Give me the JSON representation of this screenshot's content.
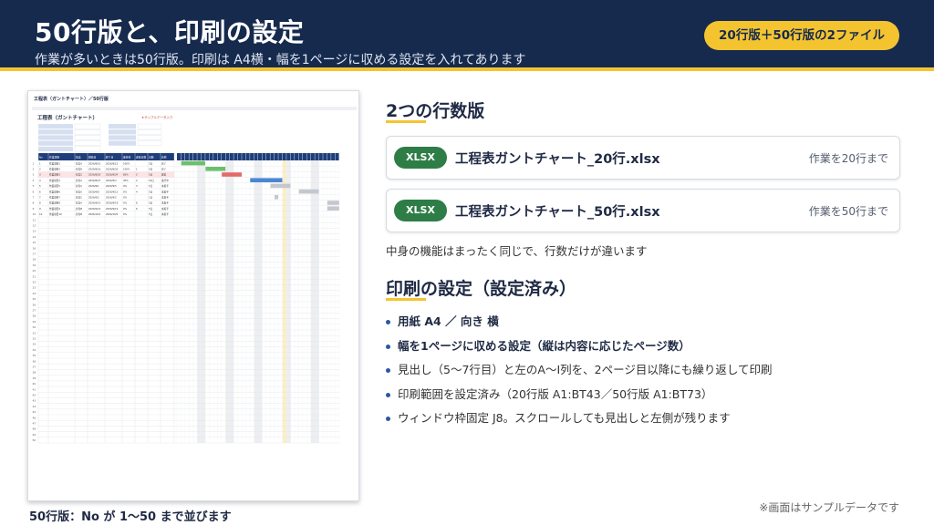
{
  "header": {
    "title": "50行版と、印刷の設定",
    "subtitle": "作業が多いときは50行版。印刷は A4横・幅を1ページに収める設定を入れてあります",
    "badge": "20行版＋50行版の2ファイル"
  },
  "screenshot": {
    "sheet_title": "工程表（ガントチャート）／50行版",
    "block_title": "工程表（ガントチャート）",
    "sample_note": "★サンプルデータ入り",
    "columns": [
      "No",
      "作業項目",
      "担当",
      "開始日",
      "終了日",
      "進捗率",
      "遅延日数",
      "日数",
      "状態"
    ],
    "rows": [
      [
        "1",
        "作業項目1",
        "担当A",
        "2026/8/10",
        "2026/8/15",
        "100%",
        "",
        "5日",
        "完了"
      ],
      [
        "2",
        "作業項目2",
        "担当B",
        "2026/8/16",
        "2026/8/20",
        "100%",
        "1",
        "5日",
        "完了"
      ],
      [
        "3",
        "作業項目3",
        "担当C",
        "2026/8/20",
        "2026/8/24",
        "60%",
        "2",
        "5日",
        "遅延"
      ],
      [
        "4",
        "作業項目4",
        "担当A",
        "2026/8/27",
        "2026/9/3",
        "30%",
        "2",
        "10日",
        "進行中"
      ],
      [
        "5",
        "作業項目5",
        "担当C",
        "2026/9/1",
        "2026/9/5",
        "0%",
        "3",
        "5日",
        "未着手"
      ],
      [
        "6",
        "作業項目6",
        "担当A",
        "2026/9/8",
        "2026/9/12",
        "0%",
        "4",
        "5日",
        "未着手"
      ],
      [
        "7",
        "作業項目7",
        "担当C",
        "2026/9/2",
        "2026/9/2",
        "0%",
        "",
        "1日",
        "未着手"
      ],
      [
        "8",
        "作業項目8",
        "担当A",
        "2026/9/15",
        "2026/9/19",
        "0%",
        "6",
        "5日",
        "未着手"
      ],
      [
        "9",
        "作業項目9",
        "担当B",
        "2026/9/15",
        "2026/9/19",
        "0%",
        "6",
        "5日",
        "未着手"
      ],
      [
        "10",
        "作業項目10",
        "担当B",
        "2026/10/1",
        "2026/10/5",
        "0%",
        "",
        "5日",
        "未着手"
      ]
    ],
    "row_count": 50,
    "caption": "50行版：No が 1〜50 まで並びます"
  },
  "section_files": {
    "title": "2つの行数版",
    "files": [
      {
        "badge": "XLSX",
        "name": "工程表ガントチャート_20行.xlsx",
        "note": "作業を20行まで"
      },
      {
        "badge": "XLSX",
        "name": "工程表ガントチャート_50行.xlsx",
        "note": "作業を50行まで"
      }
    ],
    "note": "中身の機能はまったく同じで、行数だけが違います"
  },
  "section_print": {
    "title": "印刷の設定（設定済み）",
    "bullets": [
      "用紙 A4 ／ 向き 横",
      "幅を1ページに収める設定（縦は内容に応じたページ数）",
      "見出し（5〜7行目）と左のA〜I列を、2ページ目以降にも繰り返して印刷",
      "印刷範囲を設定済み（20行版 A1:BT43／50行版 A1:BT73）",
      "ウィンドウ枠固定 J8。スクロールしても見出しと左側が残ります"
    ]
  },
  "footnote": "※画面はサンプルデータです",
  "colors": {
    "navy": "#162a4e",
    "accent": "#f4c430",
    "excel_green": "#2e7d47",
    "bullet_blue": "#2d57a3"
  }
}
